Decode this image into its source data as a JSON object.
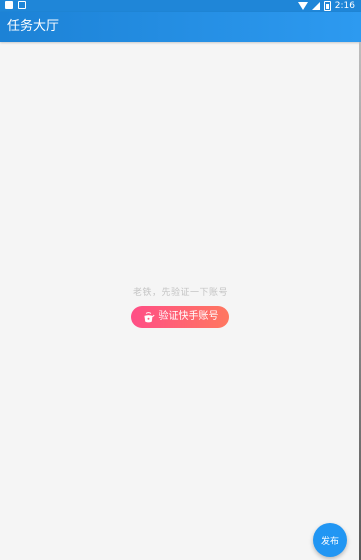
{
  "status_bar": {
    "time": "2:16",
    "icons": [
      "square-notification-icon",
      "image-notification-icon",
      "wifi-icon",
      "signal-icon",
      "battery-icon"
    ]
  },
  "app_bar": {
    "title": "任务大厅"
  },
  "empty_state": {
    "message": "老铁，先验证一下账号",
    "button_label": "验证快手账号",
    "button_icon": "kettle-icon"
  },
  "fab": {
    "label": "发布"
  },
  "colors": {
    "primary": "#1f86d8",
    "accent_gradient_start": "#ff4e86",
    "accent_gradient_end": "#ff7760",
    "fab": "#2196f3"
  }
}
